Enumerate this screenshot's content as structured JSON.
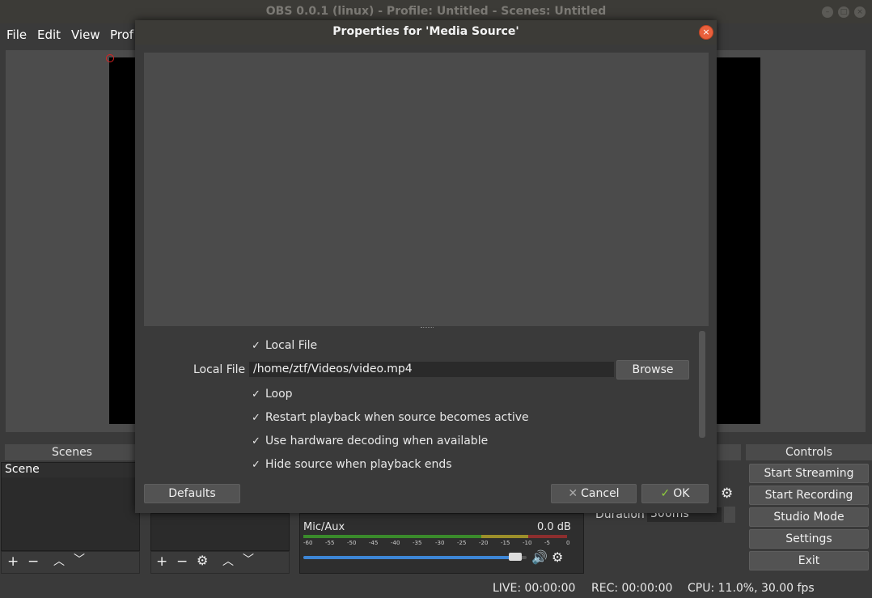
{
  "window": {
    "title": "OBS 0.0.1 (linux) - Profile: Untitled - Scenes: Untitled"
  },
  "menu": [
    "File",
    "Edit",
    "View",
    "Prof"
  ],
  "docks": {
    "scenes_header": "Scenes",
    "controls_header": "Controls"
  },
  "scenes": {
    "items": [
      "Scene"
    ]
  },
  "mixer": {
    "channel": "Mic/Aux",
    "level": "0.0 dB",
    "ticks": [
      "-60",
      "-55",
      "-50",
      "-45",
      "-40",
      "-35",
      "-30",
      "-25",
      "-20",
      "-15",
      "-10",
      "-5",
      "0"
    ],
    "volume": 0.97
  },
  "transition": {
    "duration_label": "Duration",
    "duration_value": "300ms"
  },
  "controls": [
    "Start Streaming",
    "Start Recording",
    "Studio Mode",
    "Settings",
    "Exit"
  ],
  "status": {
    "live": "LIVE: 00:00:00",
    "rec": "REC: 00:00:00",
    "cpu": "CPU: 11.0%, 30.00 fps"
  },
  "dialog": {
    "title": "Properties for 'Media Source'",
    "local_file_check": "Local File",
    "local_file_label": "Local File",
    "local_file_value": "/home/ztf/Videos/video.mp4",
    "browse_label": "Browse",
    "options": [
      "Loop",
      "Restart playback when source becomes active",
      "Use hardware decoding when available",
      "Hide source when playback ends"
    ],
    "defaults_label": "Defaults",
    "cancel_label": "Cancel",
    "ok_label": "OK"
  },
  "colors": {
    "accent_blue": "#3d86d6",
    "meter_green": "#3a8a2b",
    "meter_yellow": "#9c8f2a",
    "meter_red": "#8c2e2e"
  }
}
